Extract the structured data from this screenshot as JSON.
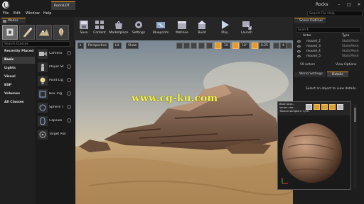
{
  "window": {
    "doc_tab": "RocksLOT",
    "app_name": "Rocks",
    "minimize": "–",
    "maximize": "□",
    "close": "×"
  },
  "menu": {
    "items": [
      "File",
      "Edit",
      "Window",
      "Help"
    ],
    "help_search_placeholder": "Search For Help"
  },
  "modes": {
    "tab_label": "Modes",
    "search_placeholder": "Search Classes",
    "categories": [
      "Recently Placed",
      "Basic",
      "Lights",
      "Visual",
      "BSP",
      "Volumes",
      "All Classes"
    ],
    "selected_category": "Basic",
    "placeables": [
      "Camera",
      "Player St",
      "Point Lig",
      "Box Trig",
      "Sphere T",
      "Capsule",
      "Target Point"
    ]
  },
  "toolbar": {
    "buttons": [
      "Save",
      "Content",
      "Marketplace",
      "Settings",
      "Blueprints",
      "Matinee",
      "Build",
      "Play",
      "Launch"
    ]
  },
  "viewport": {
    "perspective": "Perspective",
    "lit": "Lit",
    "show": "Show",
    "grid_snap": "10",
    "rotation_snap": "10°",
    "scale_snap": "0.25",
    "camera_speed": "4",
    "watermark": "www.cg-ku.com"
  },
  "outliner": {
    "tab_label": "Scene Outliner",
    "search_placeholder": "Search",
    "col_actor": "Actor",
    "col_type": "Type",
    "rows": [
      {
        "name": "mound_2",
        "type": "StaticMesh"
      },
      {
        "name": "mound_3",
        "type": "StaticMesh"
      },
      {
        "name": "mound_4",
        "type": "StaticMesh"
      },
      {
        "name": "mound_5",
        "type": "StaticMesh"
      }
    ],
    "actor_count": "59 actors",
    "view_options": "View Options"
  },
  "details": {
    "world_settings_tab": "World Settings",
    "details_tab": "Details",
    "empty_message": "Select an object to view details."
  },
  "material_preview": {
    "info_lines": [
      "Base pass...",
      "Vertex sha...",
      "Texture samplers: 1/16"
    ]
  }
}
